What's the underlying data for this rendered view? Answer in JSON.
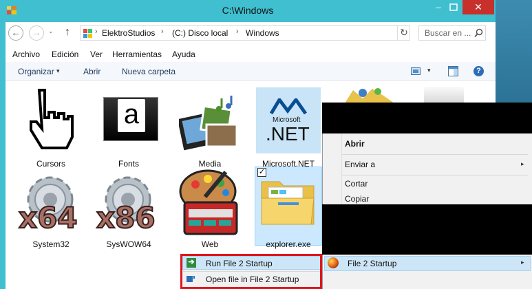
{
  "window": {
    "title": "C:\\Windows",
    "min_label": "–",
    "close_label": "✕"
  },
  "address": {
    "crumbs": [
      "ElektroStudios",
      "(C:) Disco local",
      "Windows"
    ],
    "separators": [
      "›",
      "›",
      "›"
    ],
    "dropdown": "⌄",
    "refresh": "↻"
  },
  "nav": {
    "back": "←",
    "forward": "→",
    "history": "⌄",
    "up": "↑"
  },
  "search": {
    "placeholder": "Buscar en ..."
  },
  "menubar": [
    "Archivo",
    "Edición",
    "Ver",
    "Herramientas",
    "Ayuda"
  ],
  "commands": {
    "organize": "Organizar",
    "organize_caret": "▾",
    "open": "Abrir",
    "new_folder": "Nueva carpeta",
    "view_caret": "▾",
    "help": "?"
  },
  "items": [
    {
      "label": "Cursors",
      "icon": "hand-cursor-icon"
    },
    {
      "label": "Fonts",
      "icon": "fonts-icon",
      "glyph": "a"
    },
    {
      "label": "Media",
      "icon": "media-icon"
    },
    {
      "label": "Microsoft.NET",
      "icon": "dotnet-icon",
      "brand": "Microsoft",
      "brand_text": ".NET"
    },
    {
      "label": "System32",
      "icon": "gear-x64-icon",
      "overlay": "x64"
    },
    {
      "label": "SysWOW64",
      "icon": "gear-x86-icon",
      "overlay": "x86"
    },
    {
      "label": "Web",
      "icon": "web-palette-icon"
    },
    {
      "label": "explorer.exe",
      "icon": "explorer-folder-icon",
      "selected": true,
      "check": "✓"
    }
  ],
  "context_menu": {
    "items": [
      "Abrir",
      "Enviar a",
      "Cortar",
      "Copiar"
    ],
    "send_to_arrow": "▸",
    "file2startup": {
      "label": "File 2 Startup",
      "arrow": "▸"
    }
  },
  "submenu": {
    "run": {
      "label": "Run File 2 Startup",
      "glyph": "➔"
    },
    "open": {
      "label": "Open file in File 2 Startup"
    }
  },
  "colors": {
    "titlebar": "#3fbfcf",
    "close": "#c7302b",
    "highlight": "#cde6f7",
    "annotation_box": "#e0151c"
  }
}
